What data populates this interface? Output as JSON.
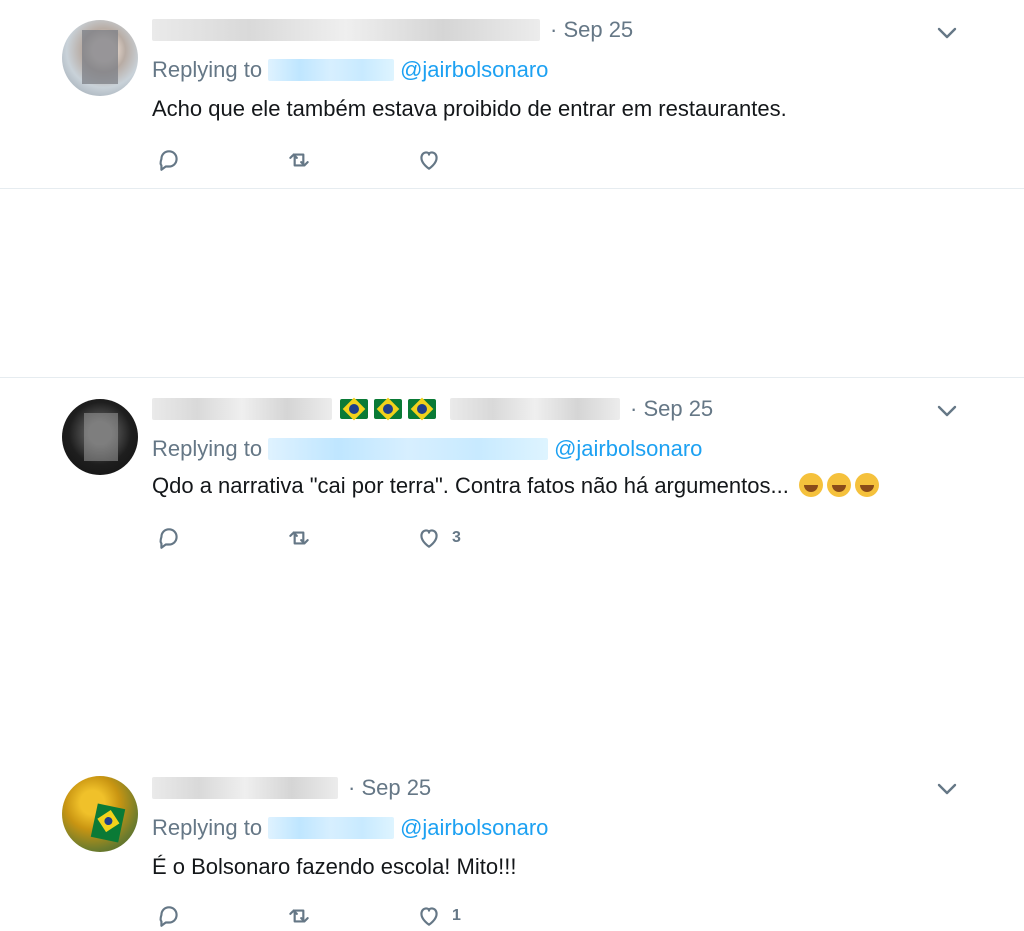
{
  "tweets": [
    {
      "date": "· Sep 25",
      "replying_label": "Replying to",
      "reply_handle": "@jairbolsonaro",
      "text": "Acho que ele também estava proibido de entrar em restaurantes.",
      "likes": ""
    },
    {
      "date": "· Sep 25",
      "replying_label": "Replying to",
      "reply_handle": "@jairbolsonaro",
      "text": "Qdo a narrativa \"cai por terra\". Contra fatos não há argumentos...",
      "likes": "3"
    },
    {
      "date": "· Sep 25",
      "replying_label": "Replying to",
      "reply_handle": "@jairbolsonaro",
      "text": "É o Bolsonaro fazendo escola! Mito!!!",
      "likes": "1"
    }
  ],
  "icons": {
    "reply": "reply-icon",
    "retweet": "retweet-icon",
    "like": "heart-icon",
    "menu": "chevron-down-icon"
  },
  "colors": {
    "link": "#1da1f2",
    "muted": "#657786",
    "text": "#14171a",
    "divider": "#e6ecf0"
  }
}
